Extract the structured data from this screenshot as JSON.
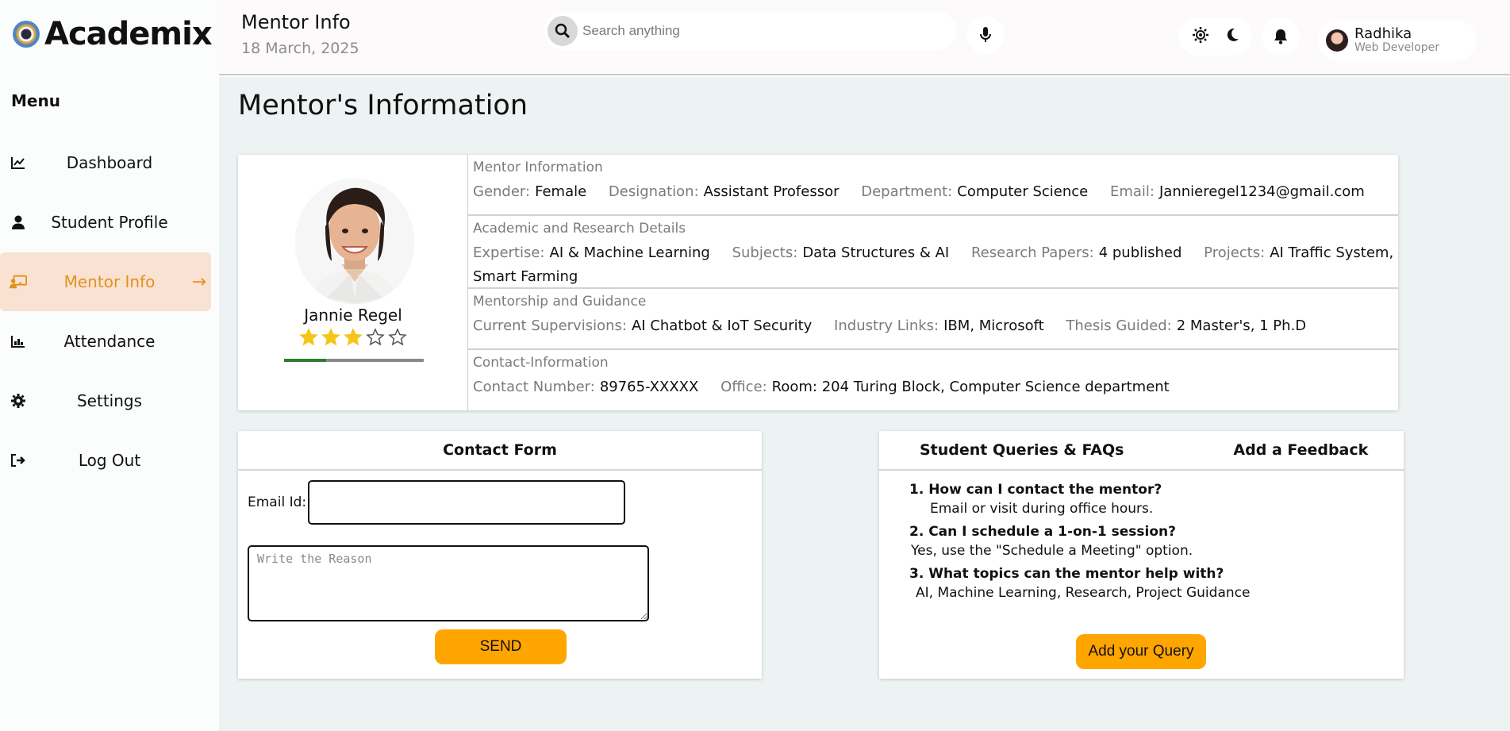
{
  "app": {
    "name": "Academix"
  },
  "sidebar": {
    "menu_title": "Menu",
    "items": [
      {
        "label": "Dashboard",
        "icon": "chart-line-icon"
      },
      {
        "label": "Student Profile",
        "icon": "user-icon"
      },
      {
        "label": "Mentor Info",
        "icon": "chalkboard-teacher-icon",
        "active": true
      },
      {
        "label": "Attendance",
        "icon": "bar-chart-icon"
      },
      {
        "label": "Settings",
        "icon": "gear-icon"
      },
      {
        "label": "Log Out",
        "icon": "logout-icon"
      }
    ]
  },
  "header": {
    "title": "Mentor Info",
    "date": "18 March, 2025",
    "search": {
      "placeholder": "Search anything",
      "value": ""
    },
    "user": {
      "name": "Radhika",
      "role": "Web Developer"
    }
  },
  "main": {
    "title": "Mentor's Information",
    "mentor": {
      "name": "Jannie Regel",
      "rating": 3,
      "rating_max": 5,
      "progress": 0.3
    },
    "sections": [
      {
        "title": "Mentor Information",
        "fields": [
          {
            "k": "Gender:",
            "v": "Female"
          },
          {
            "k": "Designation:",
            "v": "Assistant Professor"
          },
          {
            "k": "Department:",
            "v": "Computer Science"
          },
          {
            "k": "Email:",
            "v": "Jannieregel1234@gmail.com"
          }
        ]
      },
      {
        "title": "Academic and Research Details",
        "fields": [
          {
            "k": "Expertise:",
            "v": "AI & Machine Learning"
          },
          {
            "k": "Subjects:",
            "v": "Data Structures & AI"
          },
          {
            "k": "Research Papers:",
            "v": "4 published"
          },
          {
            "k": "Projects:",
            "v": "AI Traffic System, Smart Farming"
          }
        ]
      },
      {
        "title": "Mentorship and Guidance",
        "fields": [
          {
            "k": "Current Supervisions:",
            "v": "AI Chatbot & IoT Security"
          },
          {
            "k": "Industry Links:",
            "v": "IBM, Microsoft"
          },
          {
            "k": "Thesis Guided:",
            "v": "2 Master's, 1 Ph.D"
          }
        ]
      },
      {
        "title": "Contact-Information",
        "fields": [
          {
            "k": "Contact Number:",
            "v": "89765-XXXXX"
          },
          {
            "k": "Office:",
            "v": "Room: 204 Turing Block, Computer Science department"
          }
        ]
      }
    ]
  },
  "contact_form": {
    "title": "Contact Form",
    "email_label": "Email Id:",
    "email_value": "",
    "reason_placeholder": "Write the Reason",
    "send_label": "SEND"
  },
  "faq": {
    "tab_queries": "Student Queries & FAQs",
    "tab_feedback": "Add a Feedback",
    "items": [
      {
        "q": "1. How can I contact the mentor?",
        "a": "Email or visit during office hours."
      },
      {
        "q": "2. Can I schedule a 1-on-1 session?",
        "a": "Yes, use the \"Schedule a Meeting\" option."
      },
      {
        "q": "3. What topics can the mentor help with?",
        "a": "AI, Machine Learning, Research, Project Guidance"
      }
    ],
    "add_query_label": "Add your Query"
  },
  "colors": {
    "accent": "#ffa500",
    "active_nav_bg": "#f9e2d2",
    "active_nav_text": "#e2911f",
    "star": "#f5c518",
    "progress_fill": "#2e7d32"
  }
}
